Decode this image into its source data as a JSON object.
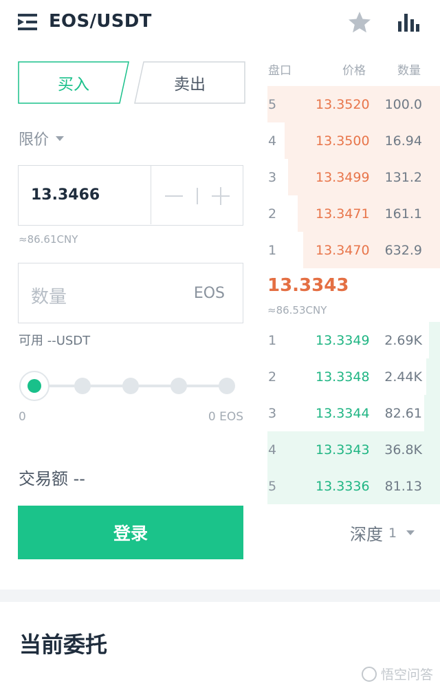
{
  "header": {
    "pair": "EOS/USDT",
    "icons": [
      "menu-icon",
      "star-icon",
      "chart-icon"
    ]
  },
  "trade": {
    "tabs": {
      "buy": "买入",
      "sell": "卖出"
    },
    "order_type": "限价",
    "price": "13.3466",
    "price_cny": "≈86.61CNY",
    "qty_placeholder": "数量",
    "qty_unit": "EOS",
    "available": "可用 --USDT",
    "slider_min": "0",
    "slider_max": "0 EOS",
    "amount": "交易额 --",
    "login_button": "登录"
  },
  "orderbook": {
    "headers": {
      "level": "盘口",
      "price": "价格",
      "qty": "数量"
    },
    "asks": [
      {
        "level": "5",
        "price": "13.3520",
        "qty": "100.0"
      },
      {
        "level": "4",
        "price": "13.3500",
        "qty": "16.94"
      },
      {
        "level": "3",
        "price": "13.3499",
        "qty": "131.2"
      },
      {
        "level": "2",
        "price": "13.3471",
        "qty": "161.1"
      },
      {
        "level": "1",
        "price": "13.3470",
        "qty": "632.9"
      }
    ],
    "last_price": "13.3343",
    "last_cny": "≈86.53CNY",
    "bids": [
      {
        "level": "1",
        "price": "13.3349",
        "qty": "2.69K"
      },
      {
        "level": "2",
        "price": "13.3348",
        "qty": "2.44K"
      },
      {
        "level": "3",
        "price": "13.3344",
        "qty": "82.61"
      },
      {
        "level": "4",
        "price": "13.3343",
        "qty": "36.8K"
      },
      {
        "level": "5",
        "price": "13.3336",
        "qty": "81.13"
      }
    ],
    "depth_label": "深度",
    "depth_value": "1"
  },
  "orders": {
    "title": "当前委托"
  },
  "watermark": "悟空问答",
  "colors": {
    "accent": "#1bc38a",
    "ask": "#e8754a",
    "bid": "#1fb583",
    "ask_bg": "#fdf0ea",
    "bid_bg": "#eaf8f2"
  }
}
